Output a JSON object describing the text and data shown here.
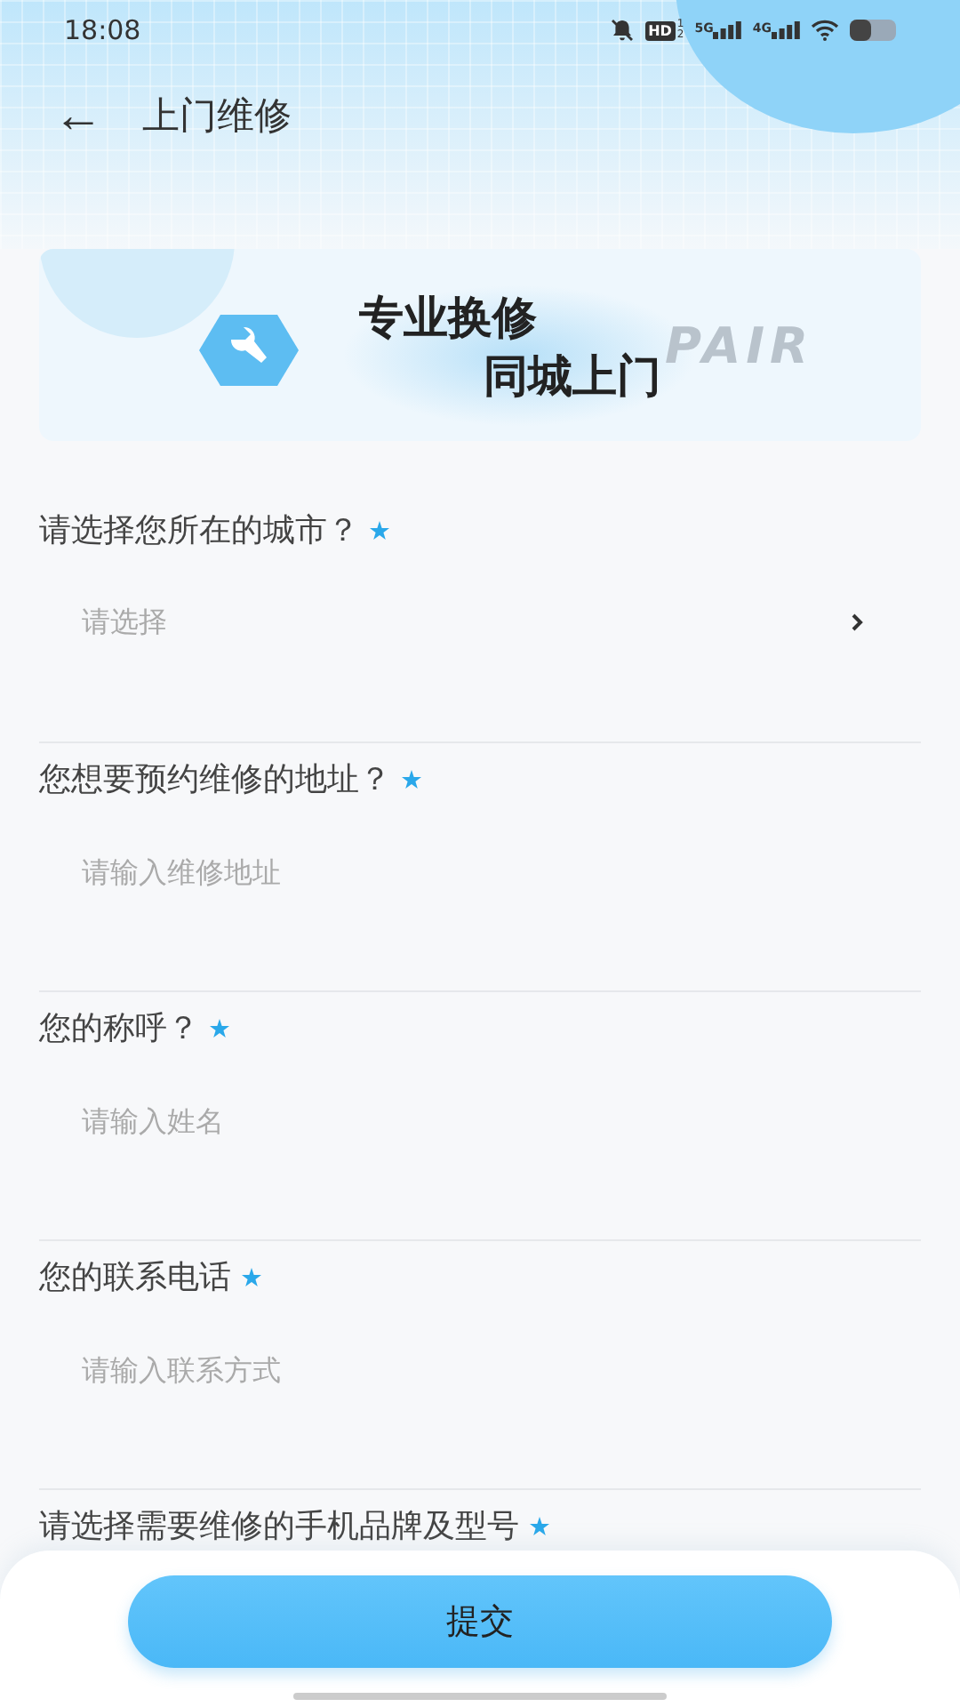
{
  "status_bar": {
    "time": "18:08",
    "hd_label": "HD",
    "hd_sims": [
      "1",
      "2"
    ],
    "networks": [
      "5G",
      "4G"
    ]
  },
  "header": {
    "back_icon": "←",
    "title": "上门维修"
  },
  "banner": {
    "lines": [
      "专业换修",
      "同城上门"
    ],
    "watermark_word": "PAIR"
  },
  "fields": [
    {
      "kind": "select",
      "label": "请选择您所在的城市？",
      "required": true,
      "placeholder": "请选择"
    },
    {
      "kind": "input",
      "label": "您想要预约维修的地址？",
      "required": true,
      "placeholder": "请输入维修地址"
    },
    {
      "kind": "input",
      "label": "您的称呼？",
      "required": true,
      "placeholder": "请输入姓名"
    },
    {
      "kind": "input",
      "label": "您的联系电话",
      "required": true,
      "placeholder": "请输入联系方式"
    },
    {
      "kind": "label_only",
      "label": "请选择需要维修的手机品牌及型号",
      "required": true
    }
  ],
  "submit_button": "提交"
}
